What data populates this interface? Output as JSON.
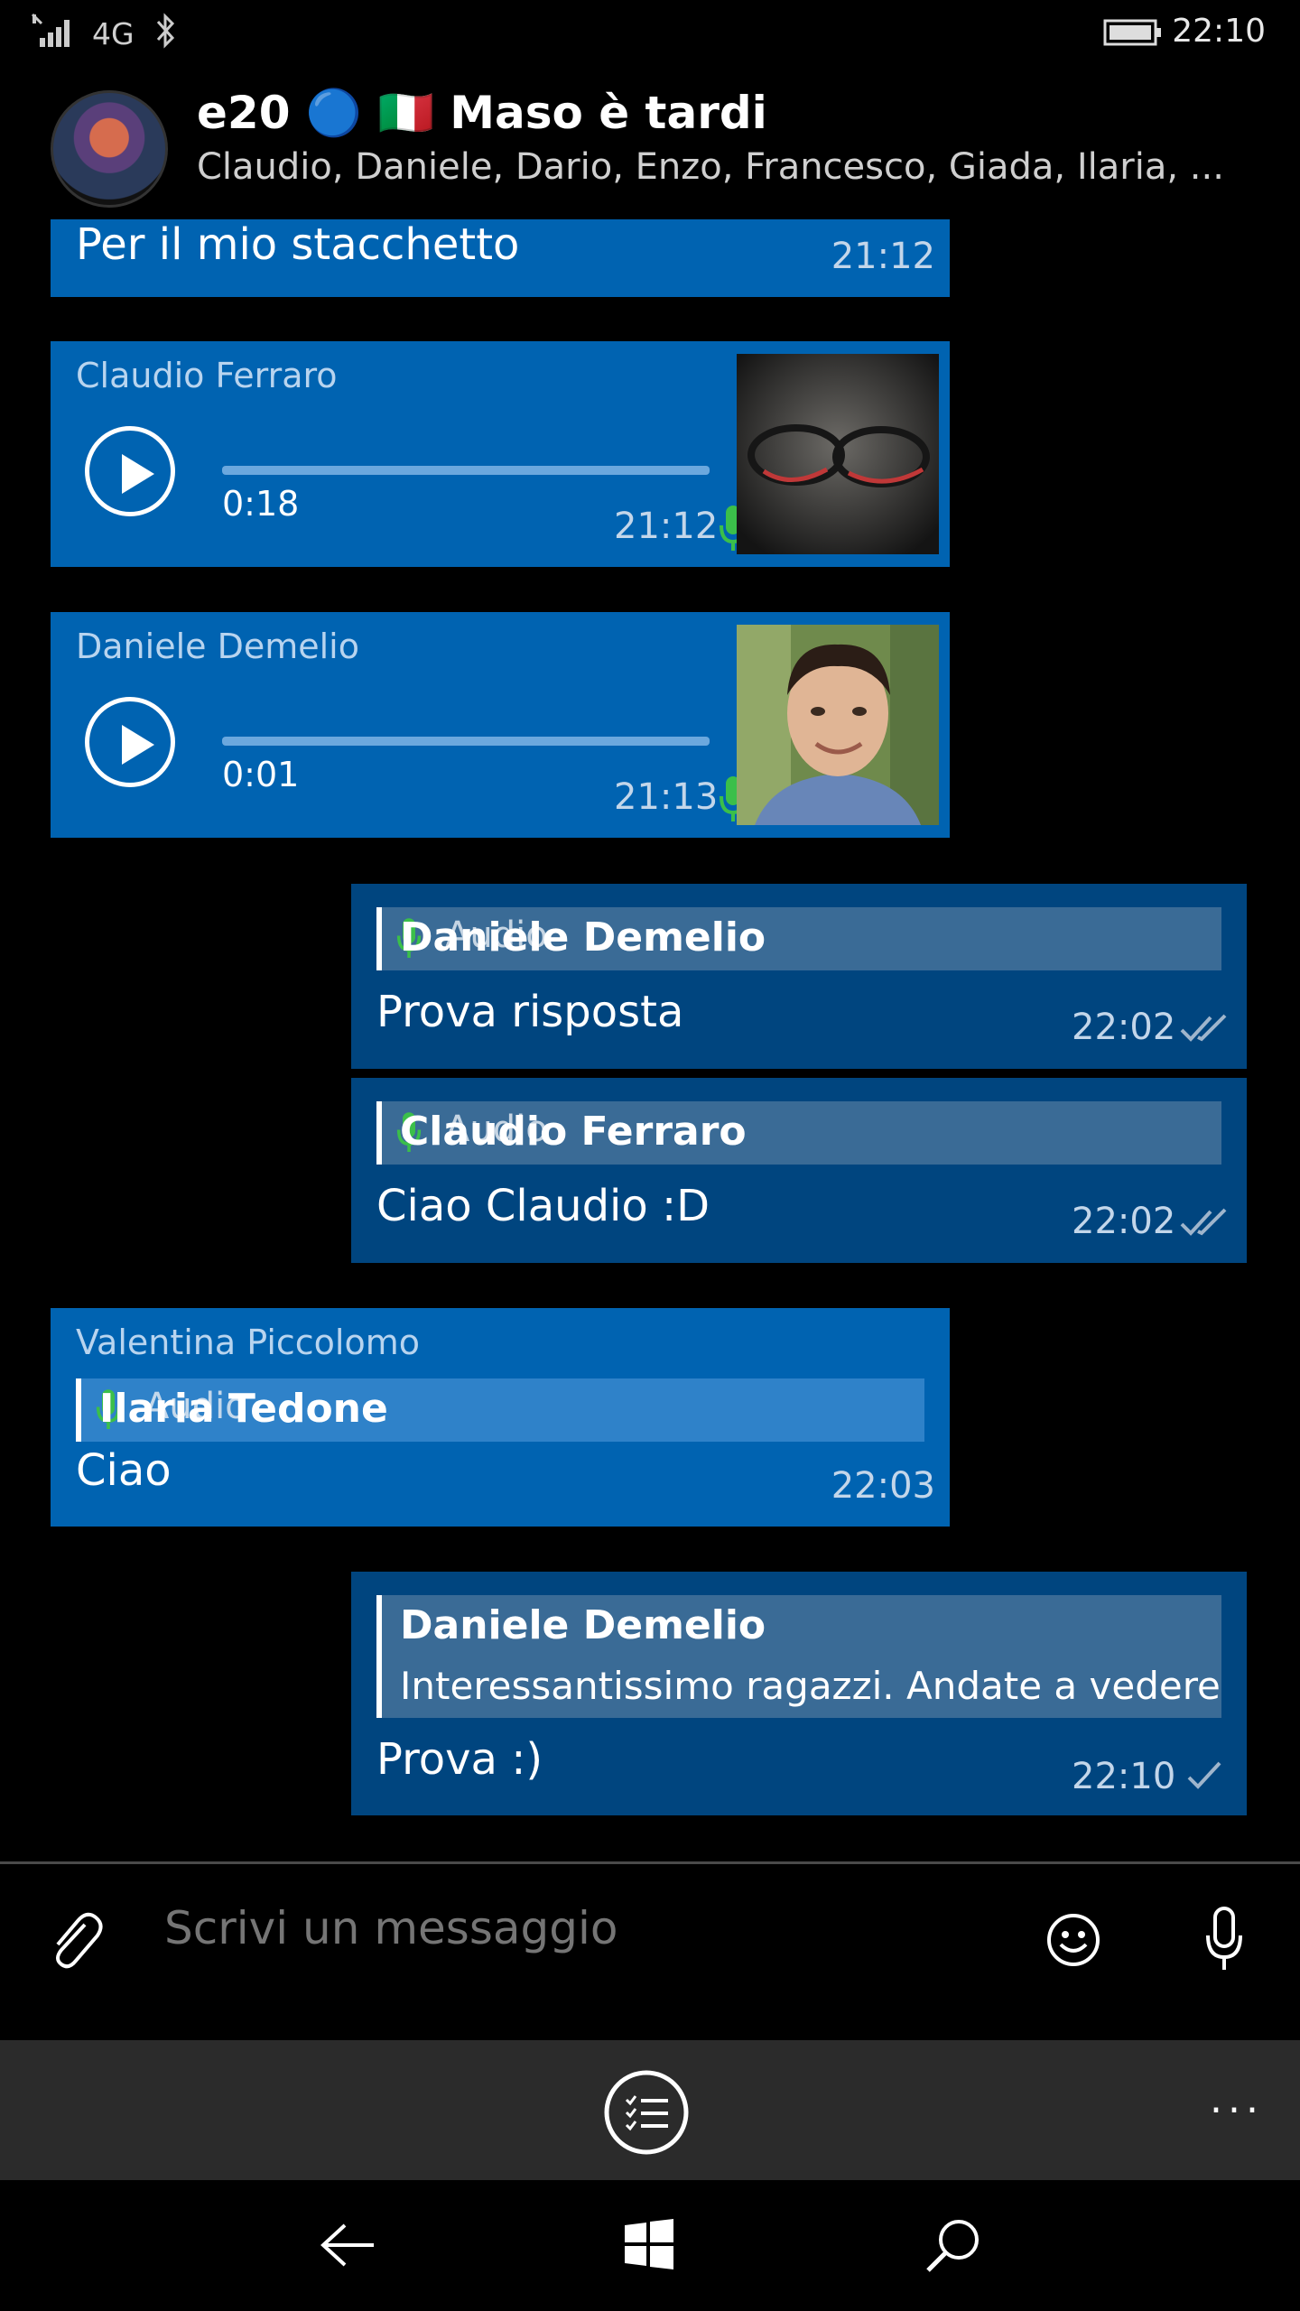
{
  "status": {
    "network": "4G",
    "time": "22:10"
  },
  "header": {
    "title": "e20 🔵 🇮🇹 Maso è tardi",
    "members": "Claudio, Daniele, Dario, Enzo, Francesco, Giada, Ilaria, ..."
  },
  "messages": [
    {
      "text": "Per il mio stacchetto",
      "time": "21:12"
    },
    {
      "sender": "Claudio Ferraro",
      "duration": "0:18",
      "time": "21:12"
    },
    {
      "sender": "Daniele Demelio",
      "duration": "0:01",
      "time": "21:13"
    },
    {
      "quote_name": "Daniele Demelio",
      "quote_audio": "Audio",
      "text": "Prova risposta",
      "time": "22:02"
    },
    {
      "quote_name": "Claudio Ferraro",
      "quote_audio": "Audio",
      "text": "Ciao Claudio :D",
      "time": "22:02"
    },
    {
      "sender": "Valentina Piccolomo",
      "quote_name": "Ilaria Tedone",
      "quote_audio": "Audio",
      "text": "Ciao",
      "time": "22:03"
    },
    {
      "quote_name": "Daniele Demelio",
      "quote_text": "Interessantissimo ragazzi. Andate a vedere",
      "text": "Prova :)",
      "time": "22:10"
    }
  ],
  "compose": {
    "placeholder": "Scrivi un messaggio"
  },
  "appbar": {
    "more": "..."
  },
  "colors": {
    "incoming": "#0063b1",
    "outgoing": "#00457f",
    "mic_accent": "#3bbf4a"
  }
}
